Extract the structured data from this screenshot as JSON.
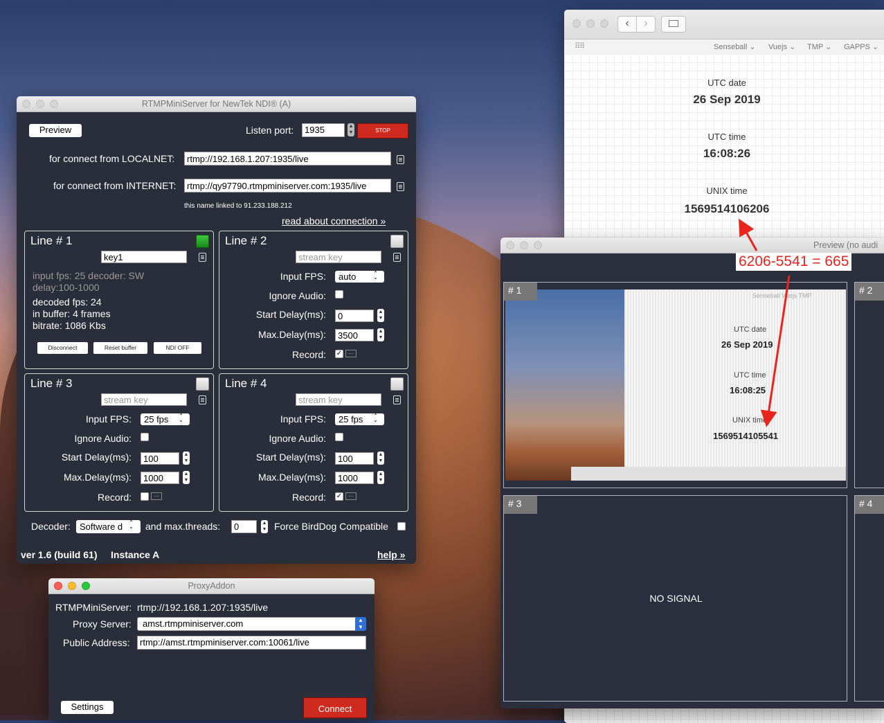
{
  "main_window": {
    "title": "RTMPMiniServer for NewTek NDI®  (A)",
    "preview_button": "Preview",
    "listen_port_label": "Listen port:",
    "listen_port_value": "1935",
    "stop_button": "STOP",
    "localnet_label": "for connect from LOCALNET:",
    "localnet_url": "rtmp://192.168.1.207:1935/live",
    "internet_label": "for connect from INTERNET:",
    "internet_url": "rtmp://qy97790.rtmpminiserver.com:1935/live",
    "linked_note": "this name linked to 91.233.188.212",
    "read_about_link": "read about connection »",
    "line1": {
      "title": "Line # 1",
      "key": "key1",
      "input_info": "input fps: 25  decoder: SW",
      "delay_info": "delay:100-1000",
      "decoded_fps": "decoded fps: 24",
      "in_buffer": "in buffer: 4 frames",
      "bitrate": "bitrate: 1086 Kbs",
      "disconnect": "Disconnect",
      "reset_buffer": "Reset buffer",
      "ndi_off": "NDI OFF"
    },
    "line2": {
      "title": "Line # 2",
      "key_placeholder": "stream key",
      "fps": "auto",
      "start_delay": "0",
      "max_delay": "3500",
      "record_checked": "✓"
    },
    "line3": {
      "title": "Line # 3",
      "key_placeholder": "stream key",
      "fps": "25 fps",
      "start_delay": "100",
      "max_delay": "1000",
      "record_checked": ""
    },
    "line4": {
      "title": "Line # 4",
      "key_placeholder": "stream key",
      "fps": "25 fps",
      "start_delay": "100",
      "max_delay": "1000",
      "record_checked": "✓"
    },
    "labels": {
      "input_fps": "Input FPS:",
      "ignore_audio": "Ignore Audio:",
      "start_delay": "Start Delay(ms):",
      "max_delay": "Max.Delay(ms):",
      "record": "Record:"
    },
    "decoder_label": "Decoder:",
    "decoder_value": "Software d",
    "max_threads_label": "and max.threads:",
    "max_threads_value": "0",
    "birddog_label": "Force BirdDog Compatible",
    "version": "ver 1.6 (build 61)",
    "instance": "Instance A",
    "help_link": "help »"
  },
  "proxy_window": {
    "title": "ProxyAddon",
    "server_label": "RTMPMiniServer:",
    "server_value": "rtmp://192.168.1.207:1935/live",
    "proxy_label": "Proxy Server:",
    "proxy_value": "amst.rtmpminiserver.com",
    "public_label": "Public Address:",
    "public_value": "rtmp://amst.rtmpminiserver.com:10061/live",
    "settings_button": "Settings",
    "connect_button": "Connect"
  },
  "browser_window": {
    "bookmarks": [
      "Senseball ⌄",
      "Vuejs ⌄",
      "TMP ⌄",
      "GAPPS ⌄"
    ],
    "utc_date_label": "UTC date",
    "utc_date": "26 Sep 2019",
    "utc_time_label": "UTC time",
    "utc_time": "16:08:26",
    "unix_label": "UNIX time",
    "unix_time": "1569514106206"
  },
  "preview_window": {
    "title": "Preview (no audi",
    "cells": [
      "# 1",
      "# 2",
      "# 3",
      "# 4"
    ],
    "no_signal": "NO SIGNAL",
    "frame_text": {
      "utc_date_label": "UTC date",
      "utc_date": "26 Sep 2019",
      "utc_time_label": "UTC time",
      "utc_time": "16:08:25",
      "unix_label": "UNIX time",
      "unix_time": "1569514105541",
      "bookmarks": "Senseball  Vuejs  TMP"
    }
  },
  "annotation": {
    "text": "6206-5541 = 665",
    "color": "#e8241b"
  }
}
